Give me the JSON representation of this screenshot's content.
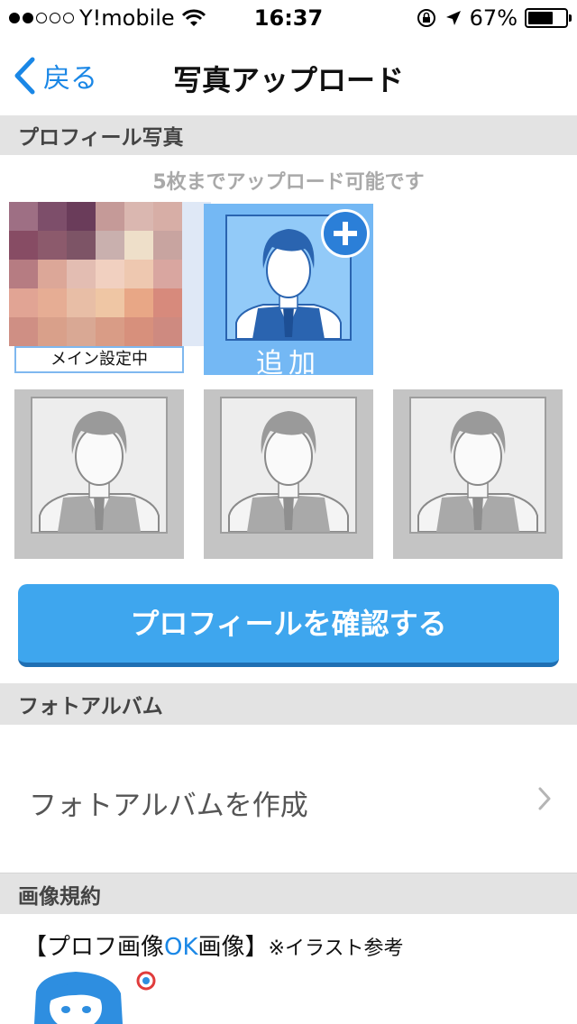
{
  "status_bar": {
    "carrier": "Y!mobile",
    "time": "16:37",
    "battery_text": "67%",
    "battery_level": 0.67,
    "signal_bars_filled": 2,
    "signal_bars_total": 5
  },
  "nav": {
    "back_label": "戻る",
    "title": "写真アップロード"
  },
  "profile_section": {
    "header": "プロフィール写真",
    "hint": "5枚までアップロード可能です",
    "main_label": "メイン設定中",
    "add_label": "追加",
    "empty_slots": 3
  },
  "confirm_button": "プロフィールを確認する",
  "album_section": {
    "header": "フォトアルバム",
    "create_label": "フォトアルバムを作成"
  },
  "terms_section": {
    "header": "画像規約",
    "line_prefix": "【プロフ画像",
    "line_ok": "OK",
    "line_suffix": "画像】",
    "line_note": "※イラスト参考"
  },
  "colors": {
    "accent": "#1a87e6",
    "button": "#3ea6ee",
    "add_tile": "#74b8f4",
    "section_header_bg": "#e3e3e3"
  }
}
